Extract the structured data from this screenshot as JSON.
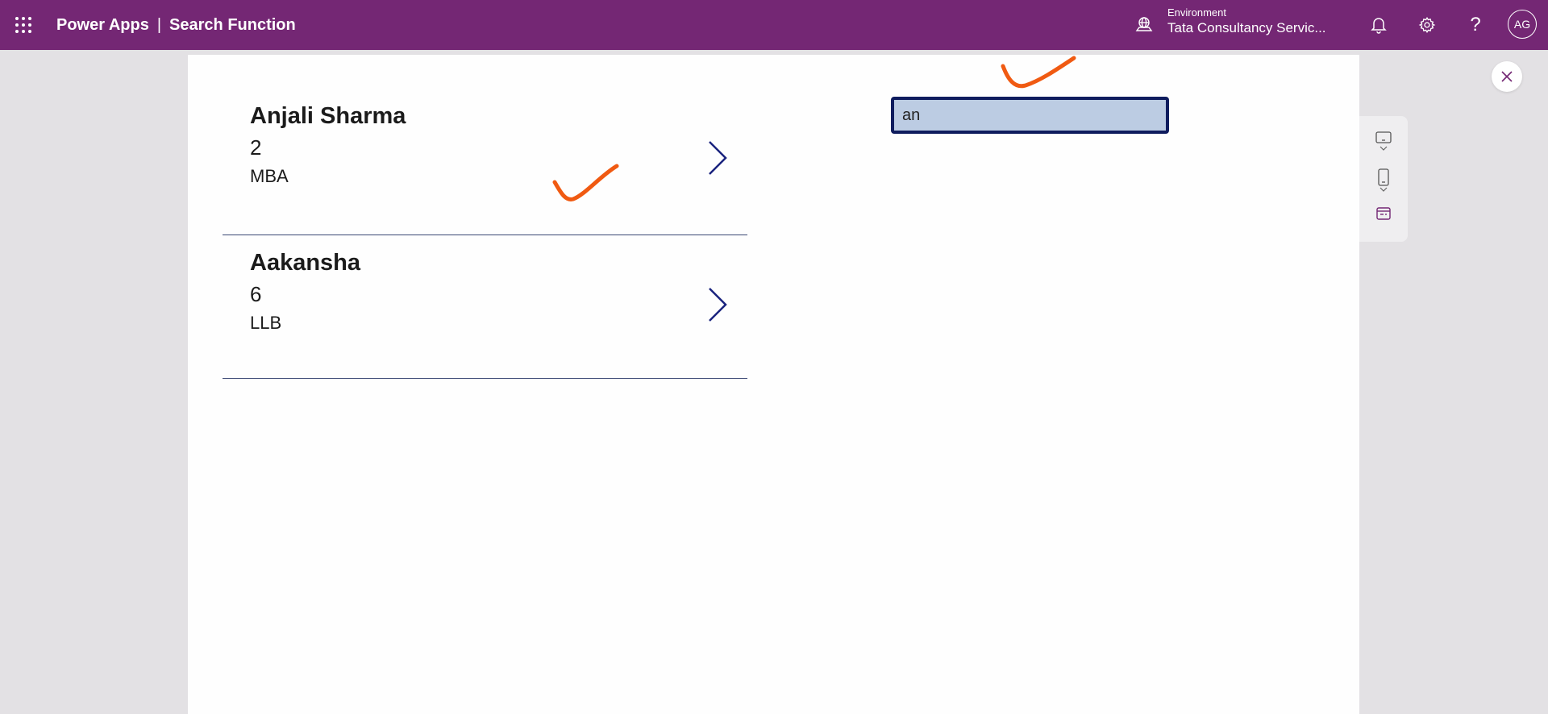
{
  "header": {
    "app_name": "Power Apps",
    "separator": "|",
    "app_title": "Search Function",
    "environment_label": "Environment",
    "environment_name": "Tata Consultancy Servic...",
    "help_label": "?",
    "avatar_initials": "AG",
    "icons": [
      "waffle-icon",
      "environment-icon",
      "bell-icon",
      "gear-icon",
      "help-icon"
    ]
  },
  "search": {
    "value": "an"
  },
  "gallery": {
    "items": [
      {
        "name": "Anjali Sharma",
        "number": "2",
        "degree": "MBA"
      },
      {
        "name": "Aakansha",
        "number": "6",
        "degree": "LLB"
      }
    ]
  },
  "side_controls": {
    "icons": [
      "close-icon",
      "desktop-layout-icon",
      "phone-layout-icon",
      "tablet-layout-icon"
    ]
  },
  "colors": {
    "header_bg": "#742774",
    "canvas_bg": "#fefefe",
    "page_bg": "#e3e1e4",
    "search_border": "#0f1c5e",
    "search_fill": "#bccce3",
    "arrow": "#1a237e",
    "annotation": "#f05a12"
  }
}
